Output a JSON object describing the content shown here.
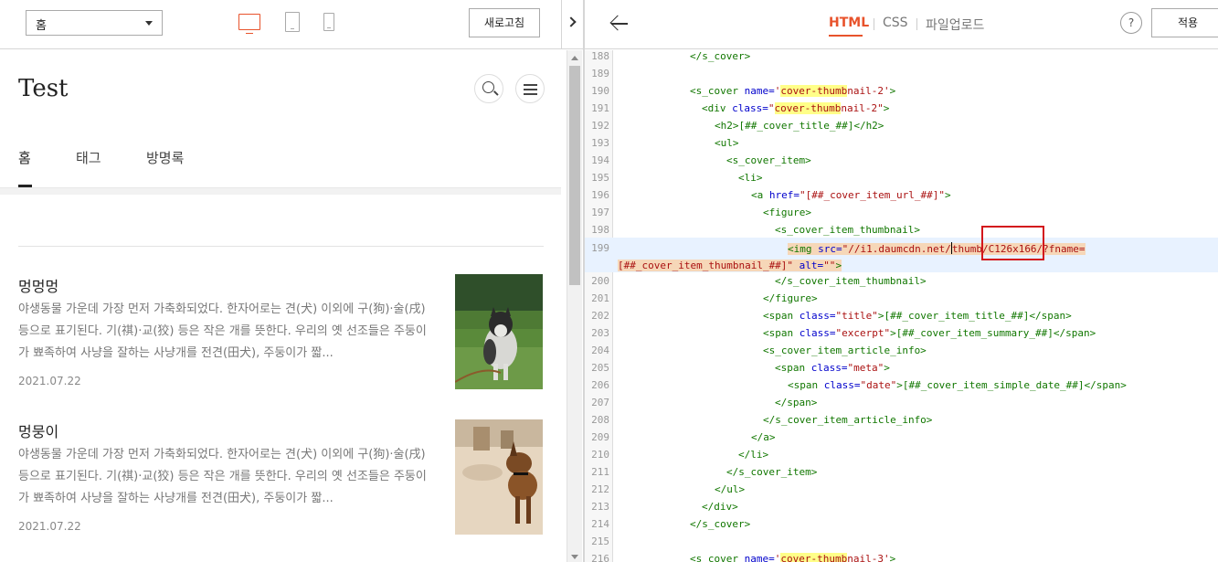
{
  "left_toolbar": {
    "page_select": "홈",
    "refresh_label": "새로고침"
  },
  "preview": {
    "blog_title": "Test",
    "nav": [
      "홈",
      "태그",
      "방명록"
    ],
    "posts": [
      {
        "title": "멍멍멍",
        "excerpt": "야생동물 가운데 가장 먼저 가축화되었다. 한자어로는 견(犬) 이외에 구(狗)·술(戌) 등으로 표기된다. 기(祺)·교(狡) 등은 작은 개를 뜻한다. 우리의 옛 선조들은 주둥이가 뾰족하여 사냥을 잘하는 사냥개를 전견(田犬), 주둥이가 짧...",
        "date": "2021.07.22"
      },
      {
        "title": "멍뭉이",
        "excerpt": "야생동물 가운데 가장 먼저 가축화되었다. 한자어로는 견(犬) 이외에 구(狗)·술(戌) 등으로 표기된다. 기(祺)·교(狡) 등은 작은 개를 뜻한다. 우리의 옛 선조들은 주둥이가 뾰족하여 사냥을 잘하는 사냥개를 전견(田犬), 주둥이가 짧...",
        "date": "2021.07.22"
      }
    ]
  },
  "editor_toolbar": {
    "tabs": [
      "HTML",
      "CSS",
      "파일업로드"
    ],
    "help_label": "?",
    "apply_label": "적용"
  },
  "code": {
    "line_numbers": [
      "188",
      "189",
      "190",
      "191",
      "192",
      "193",
      "194",
      "195",
      "196",
      "197",
      "198",
      "199",
      "",
      "200",
      "201",
      "202",
      "203",
      "204",
      "205",
      "206",
      "207",
      "208",
      "209",
      "210",
      "211",
      "212",
      "213",
      "214",
      "215",
      "216"
    ],
    "l188": "</s_cover>",
    "l190a": "<s_cover ",
    "l190b": "name=",
    "l190c": "'",
    "l190d": "cover-thumb",
    "l190e": "nail-2'",
    "l190f": ">",
    "l191a": "<div ",
    "l191b": "class=",
    "l191c": "\"",
    "l191d": "cover-thumb",
    "l191e": "nail-2\"",
    "l191f": ">",
    "l192": "<h2>[##_cover_title_##]</h2>",
    "l193": "<ul>",
    "l194": "<s_cover_item>",
    "l195": "<li>",
    "l196a": "<a ",
    "l196b": "href=",
    "l196c": "\"[##_cover_item_url_##]\"",
    "l196d": ">",
    "l197": "<figure>",
    "l198": "<s_cover_item_thumbnail>",
    "l199a": "<img ",
    "l199b": "src=",
    "l199c": "\"//i1.daumcdn.net/",
    "l199d": "thumb/C126x166/?fname=",
    "l199e": "[##_cover_item_thumbnail_##]\"",
    "l199f": " alt=",
    "l199g": "\"\"",
    "l199h": ">",
    "l200": "</s_cover_item_thumbnail>",
    "l201": "</figure>",
    "l202a": "<span ",
    "l202b": "class=",
    "l202c": "\"title\"",
    "l202d": ">[##_cover_item_title_##]</span>",
    "l203a": "<span ",
    "l203b": "class=",
    "l203c": "\"excerpt\"",
    "l203d": ">[##_cover_item_summary_##]</span>",
    "l204": "<s_cover_item_article_info>",
    "l205a": "<span ",
    "l205b": "class=",
    "l205c": "\"meta\"",
    "l205d": ">",
    "l206a": "<span ",
    "l206b": "class=",
    "l206c": "\"date\"",
    "l206d": ">[##_cover_item_simple_date_##]</span>",
    "l207": "</span>",
    "l208": "</s_cover_item_article_info>",
    "l209": "</a>",
    "l210": "</li>",
    "l211": "</s_cover_item>",
    "l212": "</ul>",
    "l213": "</div>",
    "l214": "</s_cover>",
    "l216a": "<s_cover ",
    "l216b": "name=",
    "l216c": "'",
    "l216d": "cover-thumb",
    "l216e": "nail-3'",
    "l216f": ">"
  },
  "colors": {
    "accent": "#e8532c",
    "highlight_box": "#d3161c",
    "tag": "#117700",
    "attr": "#0000cc",
    "string": "#aa1111"
  }
}
